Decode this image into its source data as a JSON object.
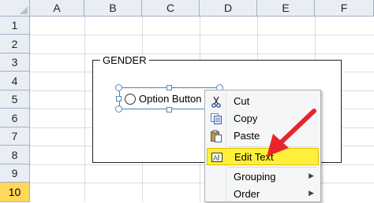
{
  "columns": [
    "A",
    "B",
    "C",
    "D",
    "E",
    "F"
  ],
  "rows": [
    "1",
    "2",
    "3",
    "4",
    "5",
    "6",
    "7",
    "8",
    "9",
    "10"
  ],
  "selected_row": "10",
  "group_box": {
    "label": "GENDER"
  },
  "option_button": {
    "label": "Option Button 3"
  },
  "context_menu": {
    "items": [
      {
        "label": "Cut",
        "icon": "scissors-icon"
      },
      {
        "label": "Copy",
        "icon": "copy-icon"
      },
      {
        "label": "Paste",
        "icon": "paste-icon"
      },
      {
        "label": "Edit Text",
        "icon": "edit-text-icon",
        "highlighted": true
      },
      {
        "label": "Grouping",
        "icon": "",
        "submenu": true
      },
      {
        "label": "Order",
        "icon": "",
        "submenu": true
      }
    ]
  },
  "colors": {
    "highlight": "#ffef3a",
    "arrow": "#e8252a",
    "selected_row_header": "#ffd75b"
  }
}
